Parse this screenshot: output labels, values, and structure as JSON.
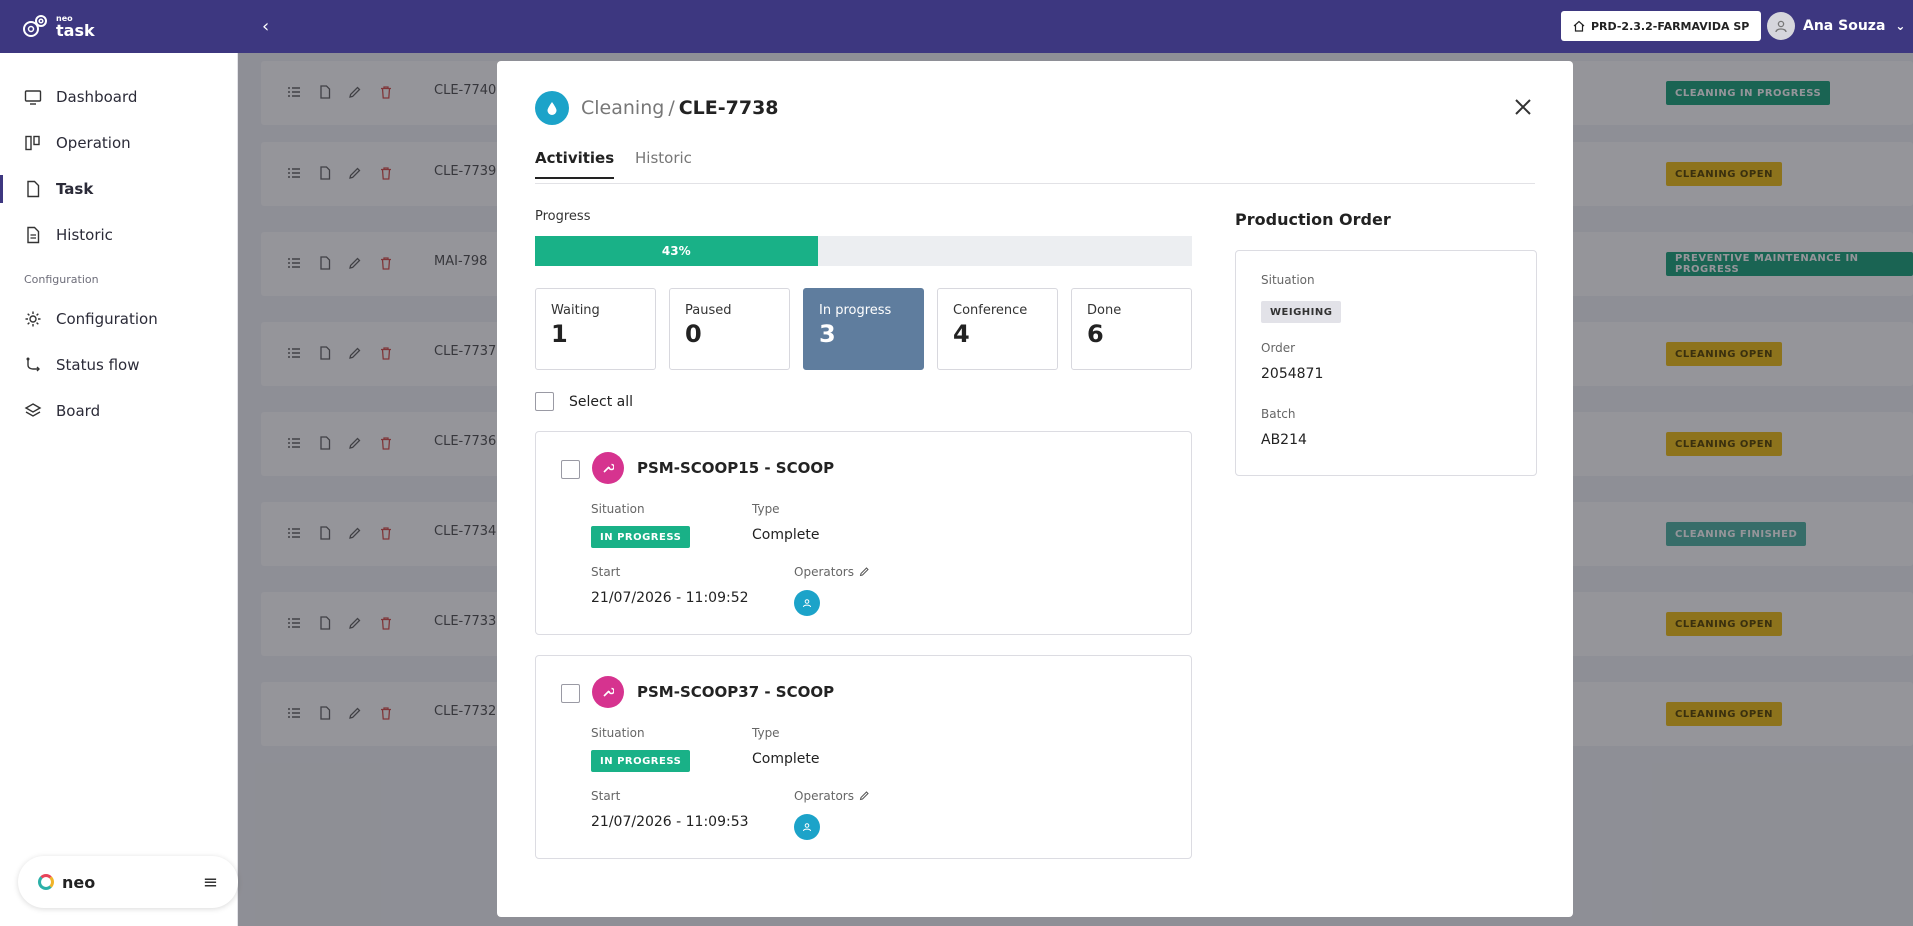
{
  "app": {
    "brand_small": "neo",
    "brand": "task"
  },
  "header": {
    "environment": "PRD-2.3.2-FARMAVIDA SP",
    "user_name": "Ana Souza"
  },
  "sidebar": {
    "items": [
      {
        "label": "Dashboard",
        "icon": "monitor-icon"
      },
      {
        "label": "Operation",
        "icon": "columns-icon"
      },
      {
        "label": "Task",
        "icon": "file-icon"
      },
      {
        "label": "Historic",
        "icon": "document-icon"
      }
    ],
    "section": "Configuration",
    "config_items": [
      {
        "label": "Configuration",
        "icon": "gear-icon"
      },
      {
        "label": "Status flow",
        "icon": "flow-icon"
      },
      {
        "label": "Board",
        "icon": "layers-icon"
      }
    ],
    "footer_label": "neo"
  },
  "rows": [
    {
      "code": "CLE-7740",
      "status": "CLEANING IN PROGRESS"
    },
    {
      "code": "CLE-7739",
      "status": "CLEANING OPEN"
    },
    {
      "code": "MAI-798",
      "status": "PREVENTIVE MAINTENANCE IN PROGRESS"
    },
    {
      "code": "CLE-7737",
      "status": "CLEANING OPEN"
    },
    {
      "code": "CLE-7736",
      "status": "CLEANING OPEN"
    },
    {
      "code": "CLE-7734",
      "status": "CLEANING FINISHED"
    },
    {
      "code": "CLE-7733",
      "status": "CLEANING OPEN"
    },
    {
      "code": "CLE-7732",
      "status": "CLEANING OPEN"
    }
  ],
  "modal": {
    "category": "Cleaning",
    "separator": "/",
    "code": "CLE-7738",
    "tabs": [
      "Activities",
      "Historic"
    ],
    "progress_label": "Progress",
    "progress_value": 0.43,
    "progress_text": "43%",
    "stats": [
      {
        "label": "Waiting",
        "value": "1"
      },
      {
        "label": "Paused",
        "value": "0"
      },
      {
        "label": "In progress",
        "value": "3"
      },
      {
        "label": "Conference",
        "value": "4"
      },
      {
        "label": "Done",
        "value": "6"
      }
    ],
    "select_all": "Select all",
    "activities": [
      {
        "name": "PSM-SCOOP15 - SCOOP",
        "situation_label": "Situation",
        "situation": "IN PROGRESS",
        "type_label": "Type",
        "type": "Complete",
        "start_label": "Start",
        "start": "21/07/2026 - 11:09:52",
        "operators_label": "Operators"
      },
      {
        "name": "PSM-SCOOP37 - SCOOP",
        "situation_label": "Situation",
        "situation": "IN PROGRESS",
        "type_label": "Type",
        "type": "Complete",
        "start_label": "Start",
        "start": "21/07/2026 - 11:09:53",
        "operators_label": "Operators"
      }
    ],
    "production_order": {
      "title": "Production Order",
      "situation_label": "Situation",
      "situation": "WEIGHING",
      "order_label": "Order",
      "order": "2054871",
      "batch_label": "Batch",
      "batch": "AB214"
    }
  }
}
